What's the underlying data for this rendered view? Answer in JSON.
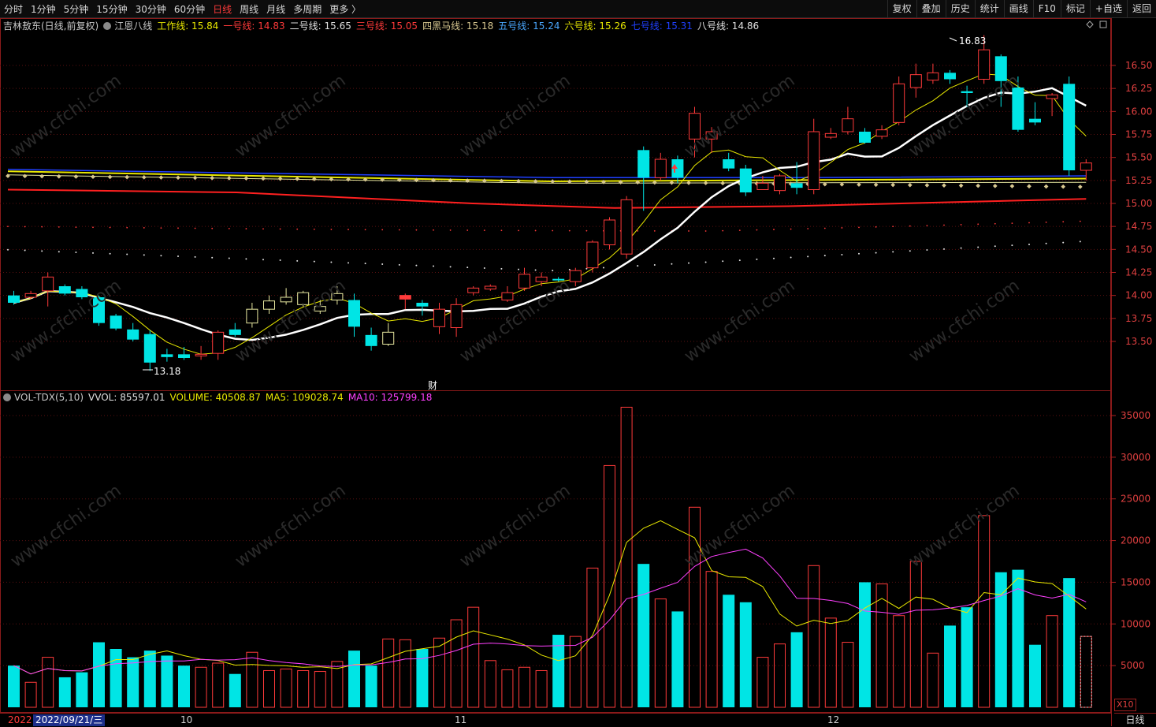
{
  "toolbar": {
    "periods": [
      "分时",
      "1分钟",
      "5分钟",
      "15分钟",
      "30分钟",
      "60分钟",
      "日线",
      "周线",
      "月线",
      "多周期",
      "更多 〉"
    ],
    "active_index": 6,
    "right_buttons": [
      "复权",
      "叠加",
      "历史",
      "统计",
      "画线",
      "F10",
      "标记",
      "+自选",
      "返回"
    ]
  },
  "price_legend": {
    "title": "吉林敖东(日线,前复权)",
    "indicator": "江恩八线",
    "items": [
      {
        "label": "工作线: 15.84",
        "color": "#e8e800"
      },
      {
        "label": "一号线: 14.83",
        "color": "#ff3a3a"
      },
      {
        "label": "二号线: 15.65",
        "color": "#e0e0e0"
      },
      {
        "label": "三号线: 15.05",
        "color": "#ff3a3a"
      },
      {
        "label": "四黑马线: 15.18",
        "color": "#d8c890"
      },
      {
        "label": "五号线: 15.24",
        "color": "#4aa8ff"
      },
      {
        "label": "六号线: 15.26",
        "color": "#e8e800"
      },
      {
        "label": "七号线: 15.31",
        "color": "#2040ff"
      },
      {
        "label": "八号线: 14.86",
        "color": "#e0e0e0"
      }
    ]
  },
  "vol_legend": {
    "title": "VOL-TDX(5,10)",
    "items": [
      {
        "label": "VVOL: 85597.01",
        "color": "#e0e0e0"
      },
      {
        "label": "VOLUME: 40508.87",
        "color": "#e8e800"
      },
      {
        "label": "MA5: 109028.74",
        "color": "#e8e800"
      },
      {
        "label": "MA10: 125799.18",
        "color": "#ff40ff"
      }
    ]
  },
  "price_axis": [
    "16.50",
    "16.25",
    "16.00",
    "15.75",
    "15.50",
    "15.25",
    "15.00",
    "14.75",
    "14.50",
    "14.25",
    "14.00",
    "13.75",
    "13.50"
  ],
  "vol_axis": [
    "35000",
    "30000",
    "25000",
    "20000",
    "15000",
    "10000",
    "5000"
  ],
  "annotations": {
    "high": "16.83",
    "low": "13.18",
    "cai": "财"
  },
  "date_axis": {
    "year": "2022",
    "cursor_date": "2022/09/21/三",
    "months": [
      "10",
      "11",
      "12"
    ]
  },
  "vol_unit": "X10",
  "period_label": "日线",
  "colors": {
    "up": "#ff3a3a",
    "down": "#00e5e5",
    "bg": "#000000"
  }
}
